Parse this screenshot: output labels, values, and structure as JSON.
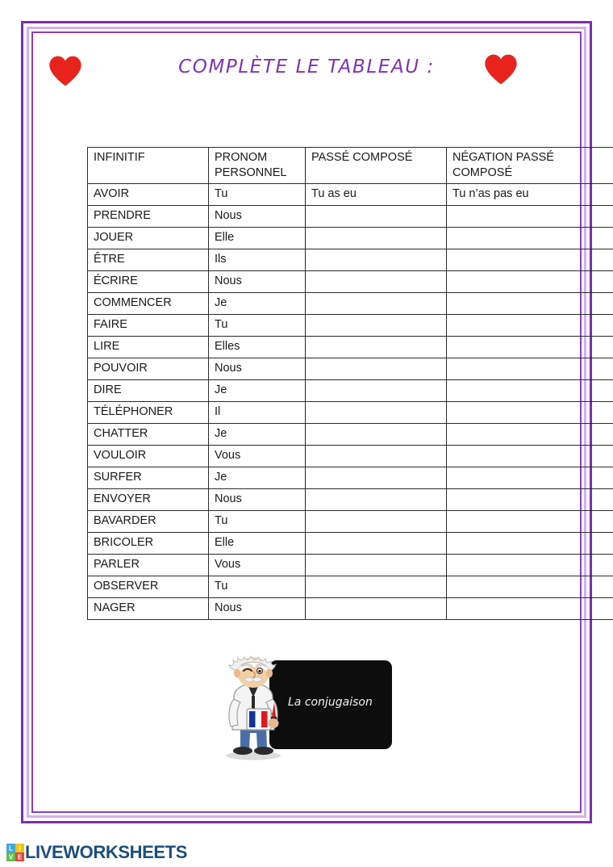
{
  "document": {
    "title": "COMPLÈTE LE TABLEAU :",
    "accent_color": "#7b34b8",
    "frame_outer_color": "#7a2fb0",
    "frame_inner_color": "#d7aeec",
    "heart_color": "#e8231e",
    "answer_color": "#e02020"
  },
  "decorations": {
    "heart_left": "heart-icon",
    "heart_right": "heart-icon"
  },
  "table": {
    "headers": [
      "INFINITIF",
      "PRONOM PERSONNEL",
      "PASSÉ COMPOSÉ",
      "NÉGATION  PASSÉ COMPOSÉ"
    ],
    "rows": [
      {
        "infinitif": "AVOIR",
        "pronom": "Tu",
        "passe_compose": "Tu as eu",
        "negation": "Tu n’as pas eu",
        "is_example": true
      },
      {
        "infinitif": "PRENDRE",
        "pronom": "Nous",
        "passe_compose": "",
        "negation": "",
        "is_example": false
      },
      {
        "infinitif": "JOUER",
        "pronom": "Elle",
        "passe_compose": "",
        "negation": "",
        "is_example": false
      },
      {
        "infinitif": "ÊTRE",
        "pronom": "Ils",
        "passe_compose": "",
        "negation": "",
        "is_example": false
      },
      {
        "infinitif": "ÉCRIRE",
        "pronom": "Nous",
        "passe_compose": "",
        "negation": "",
        "is_example": false
      },
      {
        "infinitif": "COMMENCER",
        "pronom": "Je",
        "passe_compose": "",
        "negation": "",
        "is_example": false
      },
      {
        "infinitif": "FAIRE",
        "pronom": "Tu",
        "passe_compose": "",
        "negation": "",
        "is_example": false
      },
      {
        "infinitif": "LIRE",
        "pronom": "Elles",
        "passe_compose": "",
        "negation": "",
        "is_example": false
      },
      {
        "infinitif": "POUVOIR",
        "pronom": "Nous",
        "passe_compose": "",
        "negation": "",
        "is_example": false
      },
      {
        "infinitif": "DIRE",
        "pronom": "Je",
        "passe_compose": "",
        "negation": "",
        "is_example": false
      },
      {
        "infinitif": "TÉLÉPHONER",
        "pronom": "Il",
        "passe_compose": "",
        "negation": "",
        "is_example": false
      },
      {
        "infinitif": "CHATTER",
        "pronom": "Je",
        "passe_compose": "",
        "negation": "",
        "is_example": false
      },
      {
        "infinitif": "VOULOIR",
        "pronom": "Vous",
        "passe_compose": "",
        "negation": "",
        "is_example": false
      },
      {
        "infinitif": "SURFER",
        "pronom": "Je",
        "passe_compose": "",
        "negation": "",
        "is_example": false
      },
      {
        "infinitif": "ENVOYER",
        "pronom": "Nous",
        "passe_compose": "",
        "negation": "",
        "is_example": false
      },
      {
        "infinitif": "BAVARDER",
        "pronom": "Tu",
        "passe_compose": "",
        "negation": "",
        "is_example": false
      },
      {
        "infinitif": "BRICOLER",
        "pronom": "Elle",
        "passe_compose": "",
        "negation": "",
        "is_example": false
      },
      {
        "infinitif": "PARLER",
        "pronom": "Vous",
        "passe_compose": "",
        "negation": "",
        "is_example": false
      },
      {
        "infinitif": "OBSERVER",
        "pronom": "Tu",
        "passe_compose": "",
        "negation": "",
        "is_example": false
      },
      {
        "infinitif": "NAGER",
        "pronom": "Nous",
        "passe_compose": "",
        "negation": "",
        "is_example": false
      }
    ]
  },
  "illustration": {
    "name": "professor-blackboard-illustration",
    "blackboard_text": "La conjugaison",
    "character": "einstein-professor-icon",
    "mug": "french-flag-mug-icon"
  },
  "footer": {
    "brand": "LIVEWORKSHEETS",
    "logo": "liveworksheets-logo",
    "logo_letters": [
      "L",
      "I",
      "V",
      "E"
    ],
    "brand_color": "#1c4f7c"
  }
}
